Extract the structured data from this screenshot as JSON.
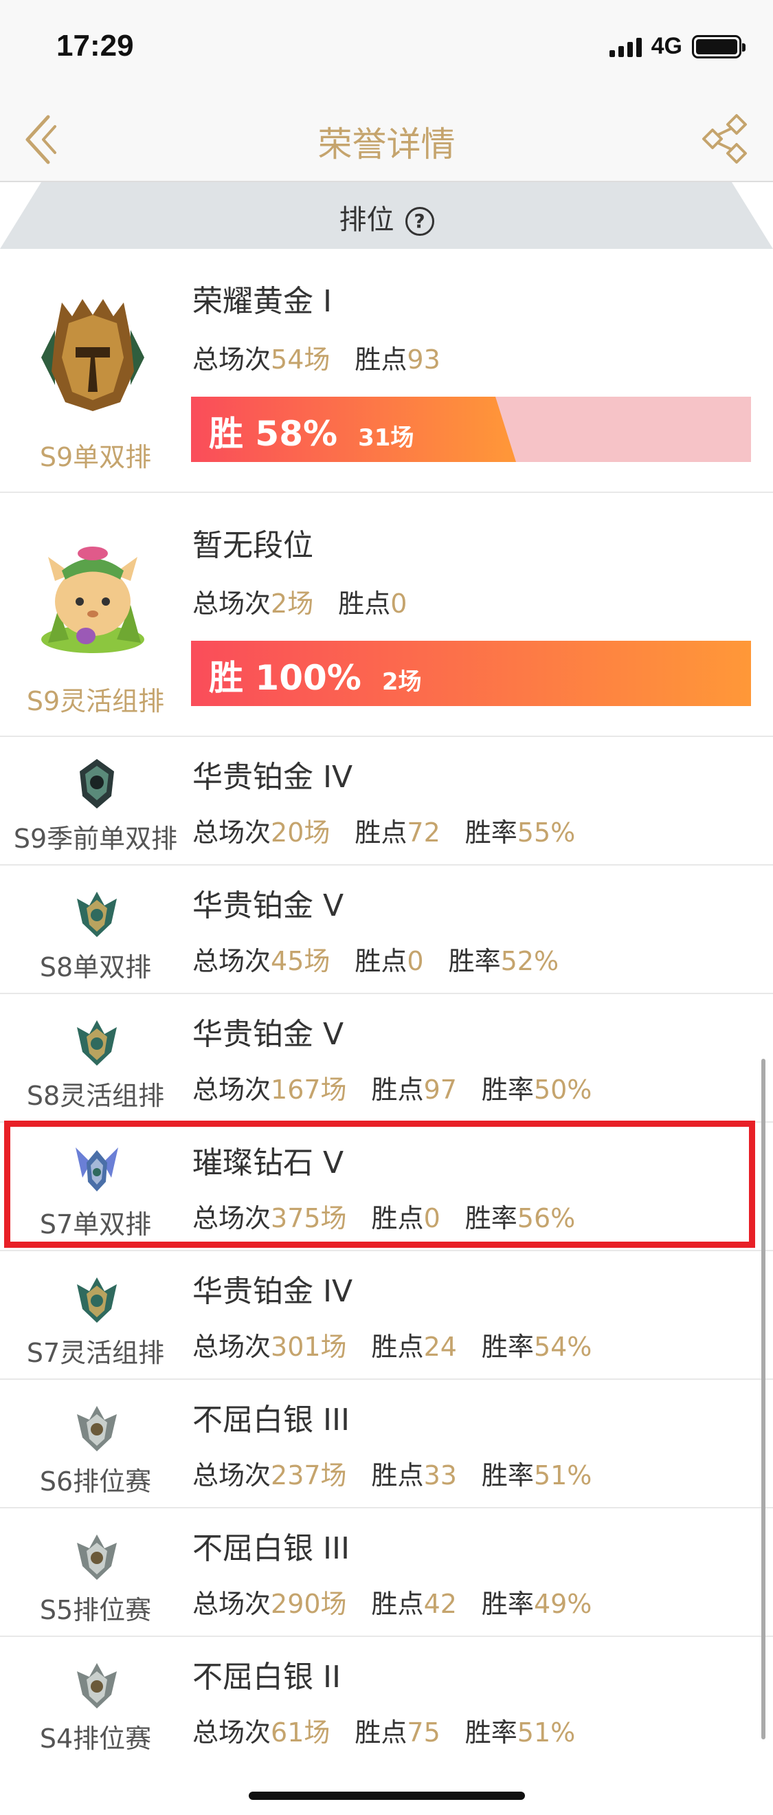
{
  "status": {
    "time": "17:29",
    "network": "4G"
  },
  "nav": {
    "title": "荣誉详情"
  },
  "section": {
    "label": "排位",
    "help_glyph": "?"
  },
  "labels": {
    "total": "总场次",
    "points": "胜点",
    "winrate": "胜率"
  },
  "ranks": [
    {
      "season": "S9单双排",
      "tier": "荣耀黄金 I",
      "total": "54场",
      "points": "93",
      "bar_pct": "胜 58%",
      "bar_wins": "31场",
      "win_fraction": 0.58,
      "icon": "gold-helmet-icon"
    },
    {
      "season": "S9灵活组排",
      "tier": "暂无段位",
      "total": "2场",
      "points": "0",
      "bar_pct": "胜 100%",
      "bar_wins": "2场",
      "win_fraction": 1.0,
      "icon": "teemo-avatar-icon"
    },
    {
      "season": "S9季前单双排",
      "tier": "华贵铂金 IV",
      "total": "20场",
      "points": "72",
      "winrate": "55%",
      "icon": "dark-emblem-icon"
    },
    {
      "season": "S8单双排",
      "tier": "华贵铂金 V",
      "total": "45场",
      "points": "0",
      "winrate": "52%",
      "icon": "platinum-emblem-icon"
    },
    {
      "season": "S8灵活组排",
      "tier": "华贵铂金 V",
      "total": "167场",
      "points": "97",
      "winrate": "50%",
      "icon": "platinum-emblem-icon"
    },
    {
      "season": "S7单双排",
      "tier": "璀璨钻石 V",
      "total": "375场",
      "points": "0",
      "winrate": "56%",
      "icon": "diamond-emblem-icon"
    },
    {
      "season": "S7灵活组排",
      "tier": "华贵铂金 IV",
      "total": "301场",
      "points": "24",
      "winrate": "54%",
      "icon": "platinum-emblem-icon"
    },
    {
      "season": "S6排位赛",
      "tier": "不屈白银 III",
      "total": "237场",
      "points": "33",
      "winrate": "51%",
      "icon": "silver-emblem-icon"
    },
    {
      "season": "S5排位赛",
      "tier": "不屈白银 III",
      "total": "290场",
      "points": "42",
      "winrate": "49%",
      "icon": "silver-emblem-icon"
    },
    {
      "season": "S4排位赛",
      "tier": "不屈白银 II",
      "total": "61场",
      "points": "75",
      "winrate": "51%",
      "icon": "silver-emblem-icon"
    }
  ],
  "colors": {
    "accent": "#c5a46d",
    "highlight": "#e82027",
    "bar_start": "#fa4d5a",
    "bar_end": "#ff9838",
    "bar_track": "#f6c3c7"
  }
}
